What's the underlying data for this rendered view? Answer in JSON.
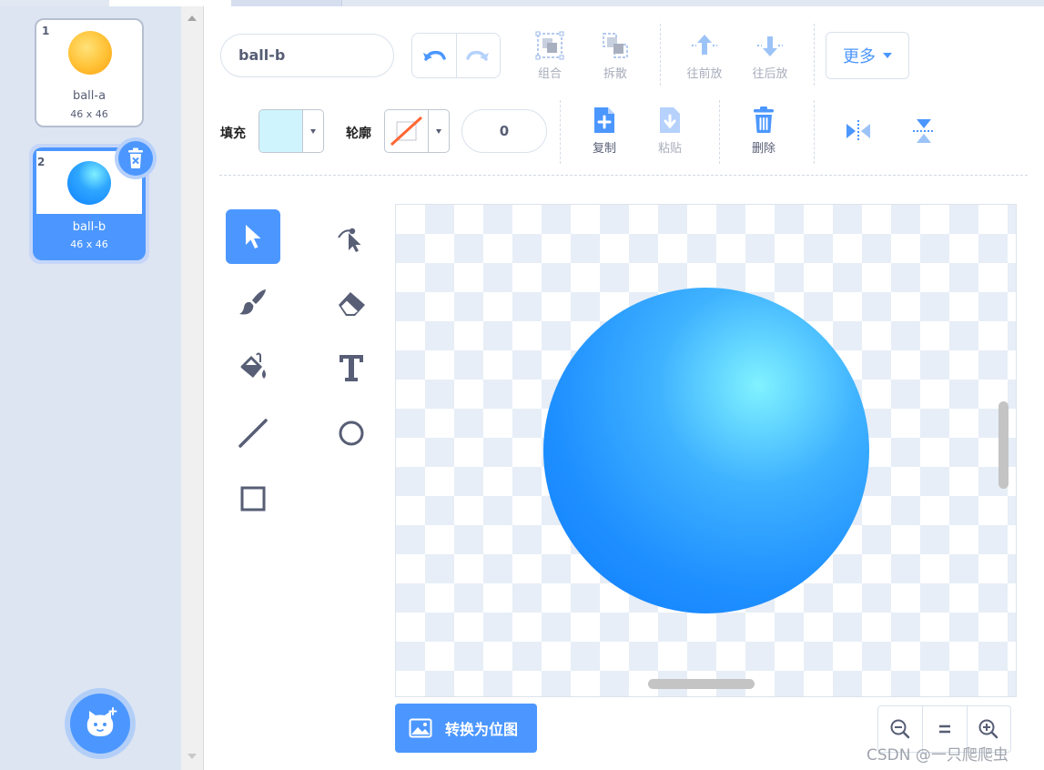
{
  "costumes": [
    {
      "number": "1",
      "name": "ball-a",
      "size": "46 x 46",
      "selected": false,
      "thumb_color": "#ffb627"
    },
    {
      "number": "2",
      "name": "ball-b",
      "size": "46 x 46",
      "selected": true,
      "thumb_color": "#2b9bff"
    }
  ],
  "toolbar": {
    "costume_name": "ball-b",
    "group_label": "组合",
    "ungroup_label": "拆散",
    "forward_label": "往前放",
    "backward_label": "往后放",
    "more_label": "更多",
    "fill_label": "填充",
    "outline_label": "轮廓",
    "outline_width": "0",
    "copy_label": "复制",
    "paste_label": "粘贴",
    "delete_label": "删除"
  },
  "colors": {
    "accent": "#4c97ff",
    "fill_swatch": "#cff4fd",
    "outline_swatch": "none",
    "disabled_text": "#a8adbb",
    "text": "#575e75"
  },
  "tools": [
    "select",
    "reshape",
    "brush",
    "eraser",
    "fill",
    "text",
    "line",
    "circle",
    "rectangle"
  ],
  "active_tool": "select",
  "convert_bitmap_label": "转换为位图",
  "zoom": {
    "out": "zoom-out",
    "reset": "=",
    "in": "zoom-in"
  },
  "watermark": "CSDN @一只爬爬虫"
}
